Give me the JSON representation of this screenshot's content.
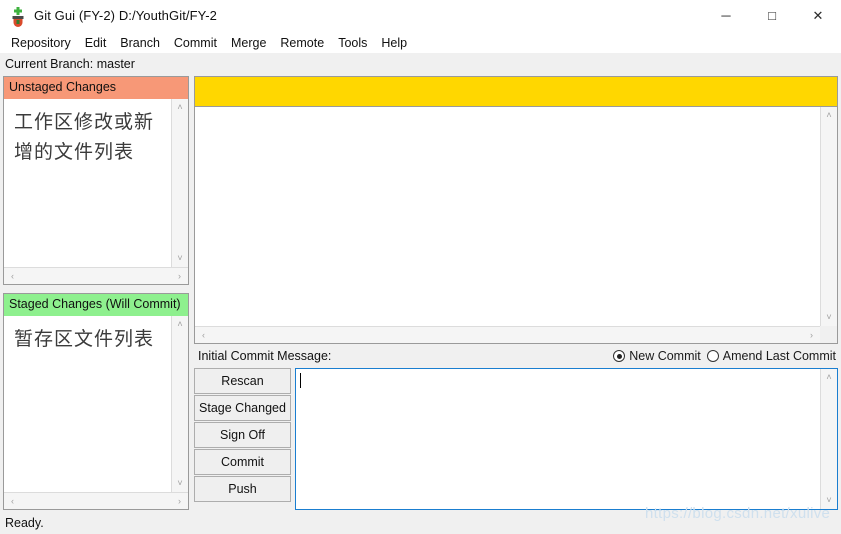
{
  "window": {
    "title": "Git Gui (FY-2) D:/YouthGit/FY-2",
    "app_icon": "git-gui-icon",
    "minimize_label": "─",
    "maximize_label": "□",
    "close_label": "✕"
  },
  "menubar": {
    "items": [
      {
        "label": "Repository"
      },
      {
        "label": "Edit"
      },
      {
        "label": "Branch"
      },
      {
        "label": "Commit"
      },
      {
        "label": "Merge"
      },
      {
        "label": "Remote"
      },
      {
        "label": "Tools"
      },
      {
        "label": "Help"
      }
    ]
  },
  "branch": {
    "line": "Current Branch: master"
  },
  "panels": {
    "unstaged": {
      "header": "Unstaged Changes",
      "header_color": "#f79877",
      "content": "工作区修改或新增的文件列表"
    },
    "staged": {
      "header": "Staged Changes (Will Commit)",
      "header_color": "#8ef08e",
      "content": "暂存区文件列表"
    }
  },
  "diff": {
    "topbar_color": "#ffd700",
    "topbar_text": "",
    "content": ""
  },
  "commit": {
    "label": "Initial Commit Message:",
    "options": [
      {
        "label": "New Commit",
        "selected": true
      },
      {
        "label": "Amend Last Commit",
        "selected": false
      }
    ],
    "message_value": ""
  },
  "buttons": [
    {
      "label": "Rescan"
    },
    {
      "label": "Stage Changed"
    },
    {
      "label": "Sign Off"
    },
    {
      "label": "Commit"
    },
    {
      "label": "Push"
    }
  ],
  "scrollbars": {
    "up": "˄",
    "down": "˅",
    "left": "‹",
    "right": "›"
  },
  "statusbar": {
    "text": "Ready."
  },
  "watermark": {
    "text": "https://blog.csdn.net/xulive"
  }
}
